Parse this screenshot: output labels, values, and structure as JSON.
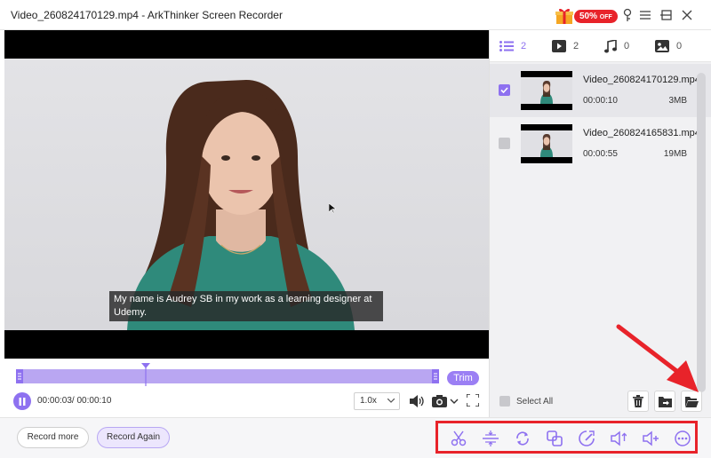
{
  "window": {
    "title": "Video_260824170129.mp4  -  ArkThinker Screen Recorder",
    "promo_percent": "50%",
    "promo_off": "OFF"
  },
  "player": {
    "subtitle": "My name is Audrey SB in my work as a learning designer at Udemy.",
    "timecode": "00:00:03/ 00:00:10",
    "speed": "1.0x",
    "trim_label": "Trim",
    "progress_fraction": 0.3
  },
  "tabs": [
    {
      "icon": "list-icon",
      "count": "2",
      "active": true
    },
    {
      "icon": "video-icon",
      "count": "2",
      "active": false
    },
    {
      "icon": "music-icon",
      "count": "0",
      "active": false
    },
    {
      "icon": "image-icon",
      "count": "0",
      "active": false
    }
  ],
  "files": [
    {
      "name": "Video_260824170129.mp4",
      "duration": "00:00:10",
      "size": "3MB",
      "checked": true
    },
    {
      "name": "Video_260824165831.mp4",
      "duration": "00:00:55",
      "size": "19MB",
      "checked": false
    }
  ],
  "panel": {
    "select_all": "Select All"
  },
  "bottom": {
    "record_more": "Record more",
    "record_again": "Record Again"
  },
  "tools": [
    "scissors-icon",
    "split-icon",
    "rotate-icon",
    "merge-icon",
    "speed-icon",
    "volume-boost-icon",
    "audio-add-icon",
    "more-icon"
  ],
  "colors": {
    "accent": "#8e71f0",
    "highlight_red": "#e8232a"
  }
}
